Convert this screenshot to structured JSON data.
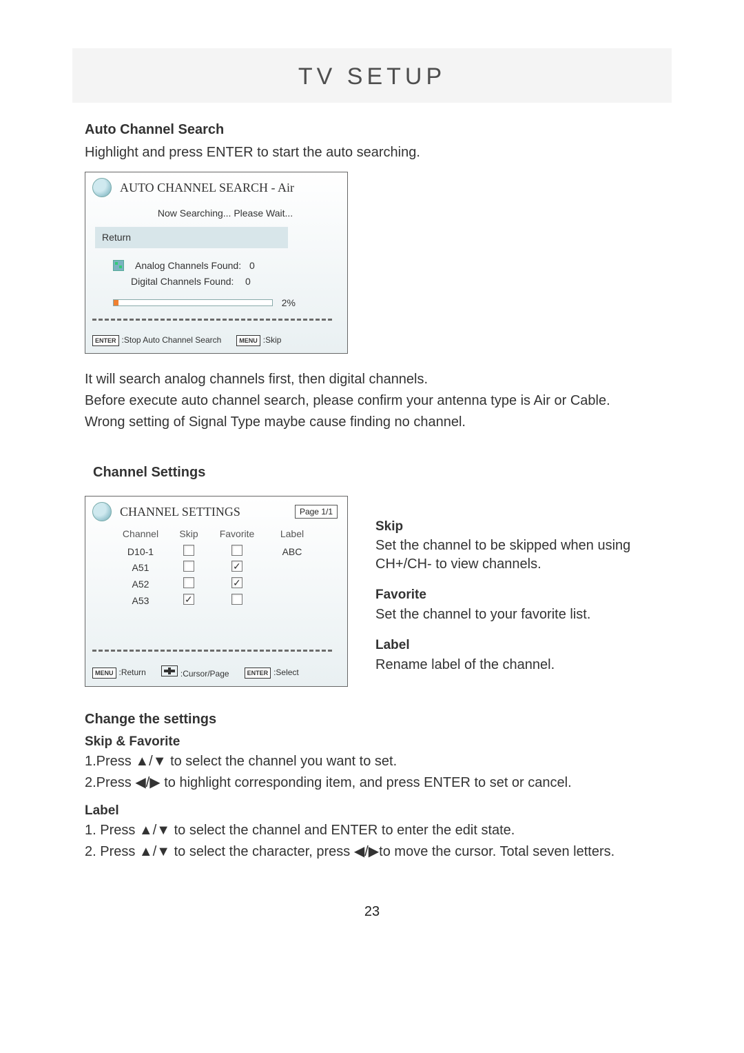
{
  "page": {
    "title": "TV SETUP",
    "number": "23"
  },
  "auto_search": {
    "heading": "Auto Channel Search",
    "intro": "Highlight and press ENTER to start the auto searching.",
    "osd_title": "AUTO CHANNEL SEARCH - Air",
    "now_searching": "Now Searching... Please Wait...",
    "return": "Return",
    "analog_label": "Analog Channels Found:",
    "analog_value": "0",
    "digital_label": "Digital Channels Found:",
    "digital_value": "0",
    "progress_pct": "2%",
    "hint_enter_key": "ENTER",
    "hint_enter": ":Stop Auto Channel Search",
    "hint_menu_key": "MENU",
    "hint_menu": ":Skip",
    "after_1": "It will search analog channels first, then digital channels.",
    "after_2": "Before execute auto channel search, please confirm your antenna type is Air or Cable.",
    "after_3": "Wrong setting of Signal Type maybe cause finding no channel."
  },
  "channel_settings": {
    "heading": "Channel Settings",
    "osd_title": "CHANNEL  SETTINGS",
    "page_label": "Page 1/1",
    "cols": {
      "channel": "Channel",
      "skip": "Skip",
      "favorite": "Favorite",
      "label": "Label"
    },
    "rows": [
      {
        "ch": "D10-1",
        "skip": false,
        "fav": false,
        "label": "ABC"
      },
      {
        "ch": "A51",
        "skip": false,
        "fav": true,
        "label": ""
      },
      {
        "ch": "A52",
        "skip": false,
        "fav": true,
        "label": ""
      },
      {
        "ch": "A53",
        "skip": true,
        "fav": false,
        "label": ""
      }
    ],
    "hint_menu_key": "MENU",
    "hint_menu": ":Return",
    "hint_cursor": ":Cursor/Page",
    "hint_enter_key": "ENTER",
    "hint_enter": ":Select",
    "skip_h": "Skip",
    "skip_p": "Set the channel to be skipped when using CH+/CH- to view channels.",
    "fav_h": "Favorite",
    "fav_p": "Set the channel to your favorite list.",
    "label_h": "Label",
    "label_p": "Rename label of the channel."
  },
  "change": {
    "heading": "Change the settings",
    "sf_heading": "Skip & Favorite",
    "sf_1": "1.Press ▲/▼ to select the channel you want to set.",
    "sf_2": "2.Press ◀/▶ to highlight corresponding item, and press ENTER to set or cancel.",
    "lb_heading": "Label",
    "lb_1": "1. Press ▲/▼ to select the channel and ENTER to enter the edit state.",
    "lb_2": "2. Press ▲/▼ to select the character, press ◀/▶to move the cursor. Total seven letters."
  }
}
